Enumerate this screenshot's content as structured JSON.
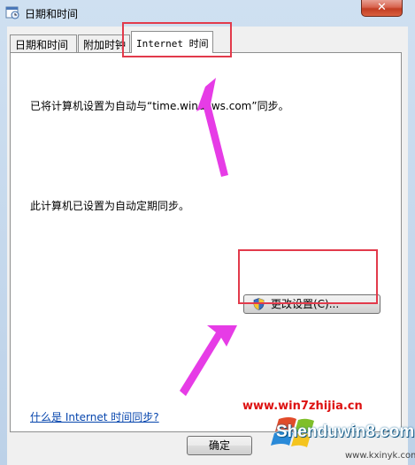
{
  "window": {
    "title": "日期和时间",
    "close_label": "✕"
  },
  "tabs": [
    {
      "label": "日期和时间"
    },
    {
      "label": "附加时钟"
    },
    {
      "label": "Internet 时间"
    }
  ],
  "panel": {
    "sync_text": "已将计算机设置为自动与“time.windows.com”同步。",
    "auto_text": "此计算机已设置为自动定期同步。",
    "change_button_label": "更改设置(C)...",
    "help_link": "什么是 Internet 时间同步?"
  },
  "footer": {
    "ok_label": "确定"
  },
  "watermark": {
    "site_url": "www.win7zhijia.cn",
    "brand": "Shenduwin8.com",
    "sub_url": "www.kxinyk.com"
  },
  "colors": {
    "highlight": "#e23a4b",
    "arrow": "#e63ce6",
    "link": "#0645ad"
  }
}
